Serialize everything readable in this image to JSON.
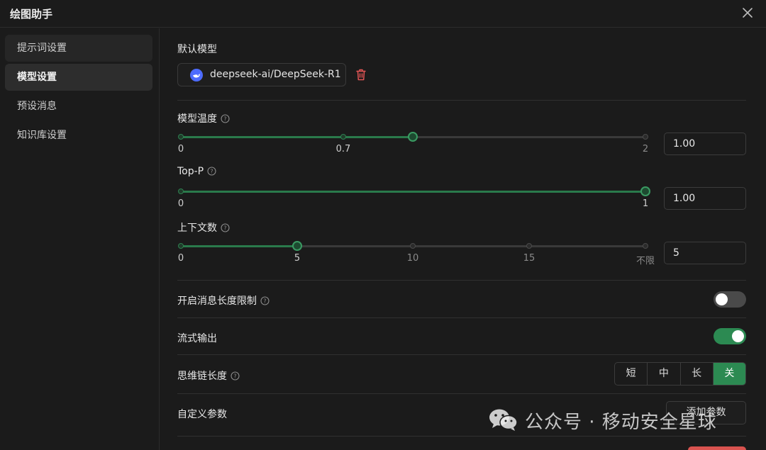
{
  "window": {
    "title": "绘图助手",
    "close_icon": "close-icon"
  },
  "sidebar": {
    "items": [
      {
        "label": "提示词设置"
      },
      {
        "label": "模型设置"
      },
      {
        "label": "预设消息"
      },
      {
        "label": "知识库设置"
      }
    ],
    "active_index": 1
  },
  "default_model": {
    "label": "默认模型",
    "model_name": "deepseek-ai/DeepSeek-R1",
    "logo_icon": "deepseek-logo-icon",
    "delete_icon": "trash-icon"
  },
  "temperature": {
    "label": "模型温度",
    "value": "1.00",
    "slider_value": 1.0,
    "min": 0,
    "max": 2,
    "ticks": [
      "0",
      "0.7",
      "2"
    ]
  },
  "top_p": {
    "label": "Top-P",
    "value": "1.00",
    "slider_value": 1.0,
    "min": 0,
    "max": 1,
    "ticks": [
      "0",
      "1"
    ]
  },
  "context_count": {
    "label": "上下文数",
    "value": "5",
    "slider_value": 5,
    "ticks": [
      "0",
      "5",
      "10",
      "15",
      "不限"
    ]
  },
  "message_length_limit": {
    "label": "开启消息长度限制",
    "enabled": false
  },
  "stream_output": {
    "label": "流式输出",
    "enabled": true
  },
  "reasoning_length": {
    "label": "思维链长度",
    "options": [
      "短",
      "中",
      "长",
      "关"
    ],
    "selected": "关"
  },
  "custom_params": {
    "label": "自定义参数",
    "add_button": "添加参数"
  },
  "watermark": {
    "text": "公众号 · 移动安全星球"
  },
  "colors": {
    "accent": "#2c8a52",
    "danger": "#d9534f",
    "background": "#1b1b1b"
  }
}
